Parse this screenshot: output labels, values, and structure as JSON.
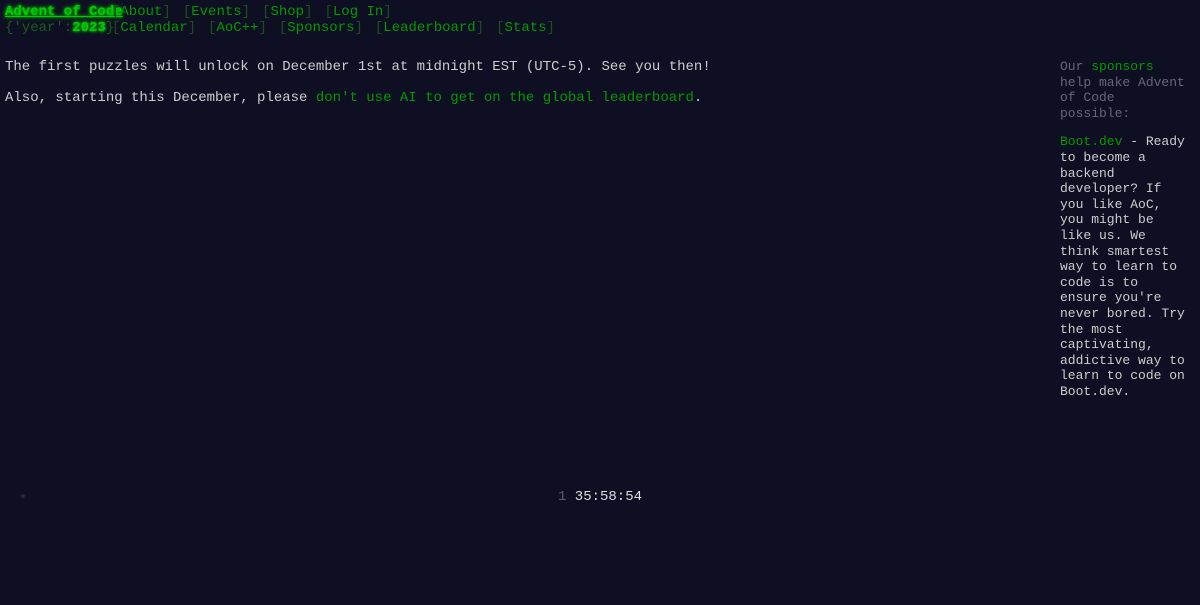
{
  "page": {
    "background_color": "#0f0f23",
    "accent_green": "#00cc00",
    "link_green": "#009900",
    "text_color": "#cccccc",
    "muted_color": "#666677"
  },
  "header": {
    "logo": "Advent of Code",
    "year_prefix": "{'year':",
    "year": "2023",
    "year_suffix": "}",
    "nav_row1": [
      {
        "label": "About",
        "open": "[",
        "close": "]"
      },
      {
        "label": "Events",
        "open": "[",
        "close": "]"
      },
      {
        "label": "Shop",
        "open": "[",
        "close": "]"
      },
      {
        "label": "Log In",
        "open": "[",
        "close": "]"
      }
    ],
    "nav_row2": [
      {
        "label": "Calendar",
        "open": "[",
        "close": "]"
      },
      {
        "label": "AoC++",
        "open": "[",
        "close": "]"
      },
      {
        "label": "Sponsors",
        "open": "[",
        "close": "]"
      },
      {
        "label": "Leaderboard",
        "open": "[",
        "close": "]"
      },
      {
        "label": "Stats",
        "open": "[",
        "close": "]"
      }
    ]
  },
  "main": {
    "paragraph1": "The first puzzles will unlock on December 1st at midnight EST (UTC-5). See you then!",
    "paragraph2_before": "Also, starting this December, please ",
    "paragraph2_link": "don't use AI to get on the global leaderboard",
    "paragraph2_after": "."
  },
  "sidebar": {
    "intro_before": "Our ",
    "intro_link": "sponsors",
    "intro_after": " help make Advent of Code possible:",
    "sponsor_name": "Boot.dev",
    "sponsor_text": " - Ready to become a backend developer? If you like AoC, you might be like us. We think smartest way to learn to code is to ensure you're never bored. Try the most captivating, addictive way to learn to code on Boot.dev."
  },
  "countdown": {
    "days": "1",
    "clock": "35:58:54"
  },
  "decoration": {
    "star_glyph": "✶"
  }
}
